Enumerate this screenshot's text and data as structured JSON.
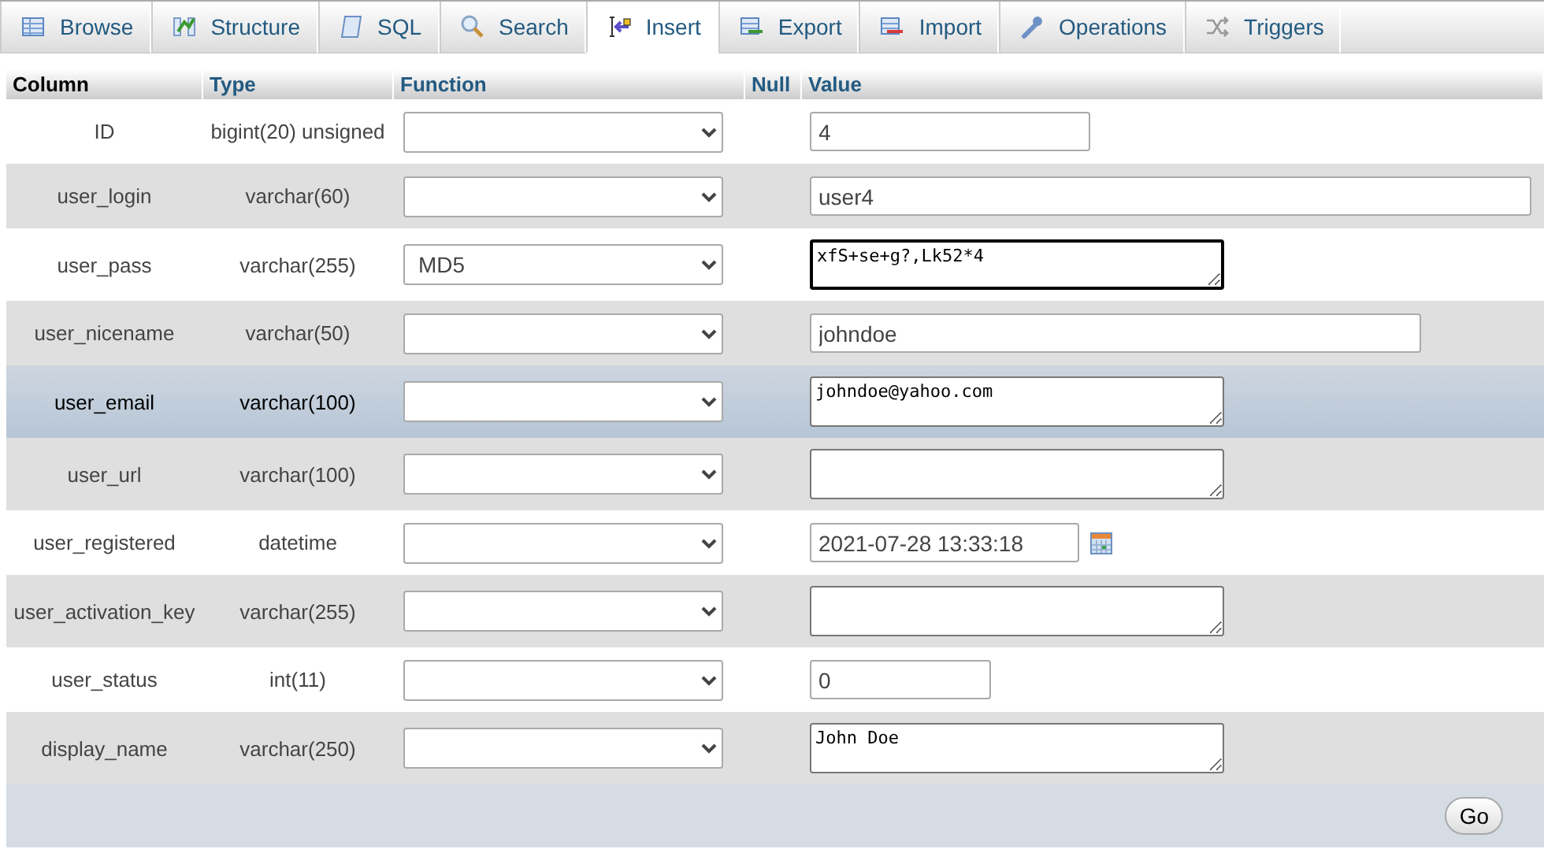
{
  "tabs": [
    {
      "label": "Browse",
      "selected": false
    },
    {
      "label": "Structure",
      "selected": false
    },
    {
      "label": "SQL",
      "selected": false
    },
    {
      "label": "Search",
      "selected": false
    },
    {
      "label": "Insert",
      "selected": true
    },
    {
      "label": "Export",
      "selected": false
    },
    {
      "label": "Import",
      "selected": false
    },
    {
      "label": "Operations",
      "selected": false
    },
    {
      "label": "Triggers",
      "selected": false
    }
  ],
  "table": {
    "columns": [
      "Column",
      "Type",
      "Function",
      "Null",
      "Value"
    ],
    "rows": [
      {
        "column": "ID",
        "type": "bigint(20) unsigned",
        "function": "",
        "value": "4",
        "kind": "id",
        "highlighted": false
      },
      {
        "column": "user_login",
        "type": "varchar(60)",
        "function": "",
        "value": "user4",
        "kind": "wide",
        "highlighted": false
      },
      {
        "column": "user_pass",
        "type": "varchar(255)",
        "function": "MD5",
        "value": "xfS+se+g?,Lk52*4",
        "kind": "memo",
        "highlighted": false,
        "focused": true
      },
      {
        "column": "user_nicename",
        "type": "varchar(50)",
        "function": "",
        "value": "johndoe",
        "kind": "medium",
        "highlighted": false
      },
      {
        "column": "user_email",
        "type": "varchar(100)",
        "function": "",
        "value": "johndoe@yahoo.com",
        "kind": "memo",
        "highlighted": true,
        "focused": false
      },
      {
        "column": "user_url",
        "type": "varchar(100)",
        "function": "",
        "value": "",
        "kind": "memo",
        "highlighted": false,
        "focused": false
      },
      {
        "column": "user_registered",
        "type": "datetime",
        "function": "",
        "value": "2021-07-28 13:33:18",
        "kind": "date",
        "highlighted": false
      },
      {
        "column": "user_activation_key",
        "type": "varchar(255)",
        "function": "",
        "value": "",
        "kind": "memo",
        "highlighted": false,
        "focused": false
      },
      {
        "column": "user_status",
        "type": "int(11)",
        "function": "",
        "value": "0",
        "kind": "small",
        "highlighted": false
      },
      {
        "column": "display_name",
        "type": "varchar(250)",
        "function": "",
        "value": "John Doe",
        "kind": "memo",
        "highlighted": false,
        "focused": false
      }
    ]
  },
  "go_button": "Go"
}
